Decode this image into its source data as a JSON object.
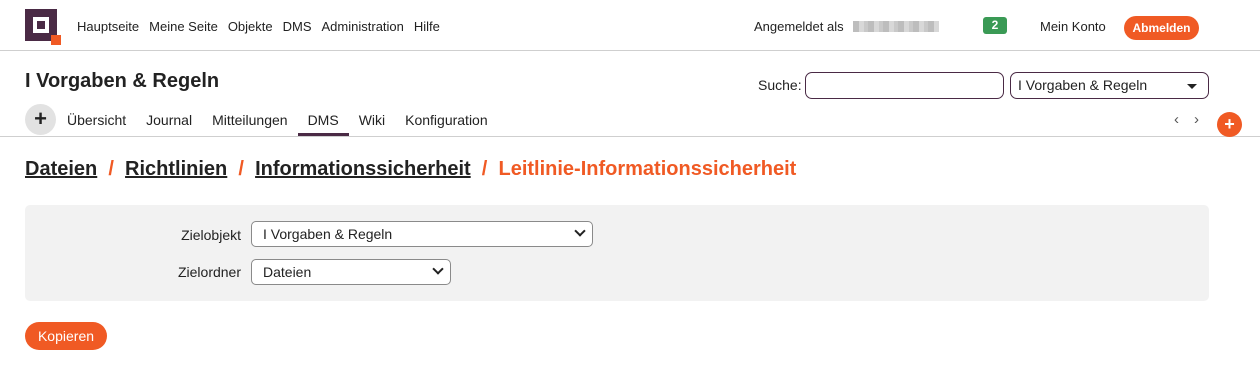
{
  "nav": {
    "items": [
      "Hauptseite",
      "Meine Seite",
      "Objekte",
      "DMS",
      "Administration",
      "Hilfe"
    ],
    "logged_in_label": "Angemeldet als",
    "notification_count": "2",
    "my_account": "Mein Konto",
    "logout": "Abmelden"
  },
  "project": {
    "title": "I Vorgaben & Regeln",
    "search_label": "Suche:",
    "search_value": "",
    "selected_project": "I Vorgaben & Regeln"
  },
  "tabs": {
    "add_label": "+",
    "items": [
      "Übersicht",
      "Journal",
      "Mitteilungen",
      "DMS",
      "Wiki",
      "Konfiguration"
    ],
    "active_index": 3,
    "prev": "‹",
    "next": "›",
    "fab_label": "+"
  },
  "breadcrumb": {
    "items": [
      "Dateien",
      "Richtlinien",
      "Informationssicherheit"
    ],
    "separator": "/",
    "current": "Leitlinie-Informationssicherheit"
  },
  "form": {
    "target_object_label": "Zielobjekt",
    "target_object_value": "I Vorgaben & Regeln",
    "target_folder_label": "Zielordner",
    "target_folder_value": "Dateien"
  },
  "actions": {
    "copy_label": "Kopieren"
  },
  "colors": {
    "brand": "#4a2a45",
    "accent": "#f05a24",
    "badge": "#3a9a55"
  }
}
